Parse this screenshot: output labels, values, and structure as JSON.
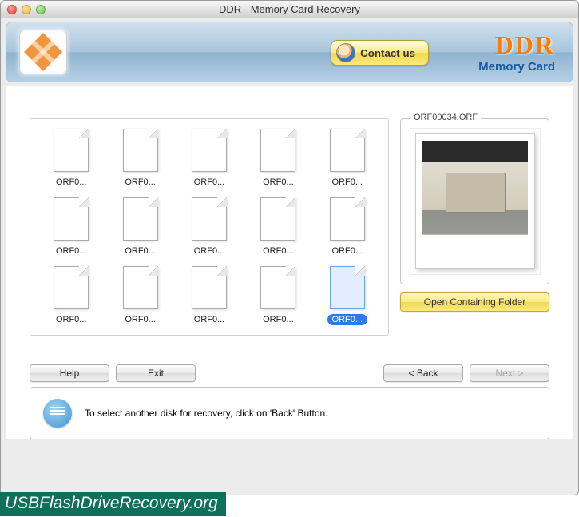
{
  "titlebar": {
    "title": "DDR - Memory Card Recovery"
  },
  "header": {
    "contact_label": "Contact us",
    "brand_top": "DDR",
    "brand_sub": "Memory Card"
  },
  "files": [
    {
      "label": "ORF0...",
      "selected": false
    },
    {
      "label": "ORF0...",
      "selected": false
    },
    {
      "label": "ORF0...",
      "selected": false
    },
    {
      "label": "ORF0...",
      "selected": false
    },
    {
      "label": "ORF0...",
      "selected": false
    },
    {
      "label": "ORF0...",
      "selected": false
    },
    {
      "label": "ORF0...",
      "selected": false
    },
    {
      "label": "ORF0...",
      "selected": false
    },
    {
      "label": "ORF0...",
      "selected": false
    },
    {
      "label": "ORF0...",
      "selected": false
    },
    {
      "label": "ORF0...",
      "selected": false
    },
    {
      "label": "ORF0...",
      "selected": false
    },
    {
      "label": "ORF0...",
      "selected": false
    },
    {
      "label": "ORF0...",
      "selected": false
    },
    {
      "label": "ORF0...",
      "selected": true
    }
  ],
  "preview": {
    "legend": "ORF00034.ORF",
    "open_folder_label": "Open Containing Folder"
  },
  "buttons": {
    "help": "Help",
    "exit": "Exit",
    "back": "< Back",
    "next": "Next >"
  },
  "info": {
    "text": "To select another disk for recovery, click on 'Back' Button."
  },
  "footer": {
    "text": "USBFlashDriveRecovery.org"
  }
}
